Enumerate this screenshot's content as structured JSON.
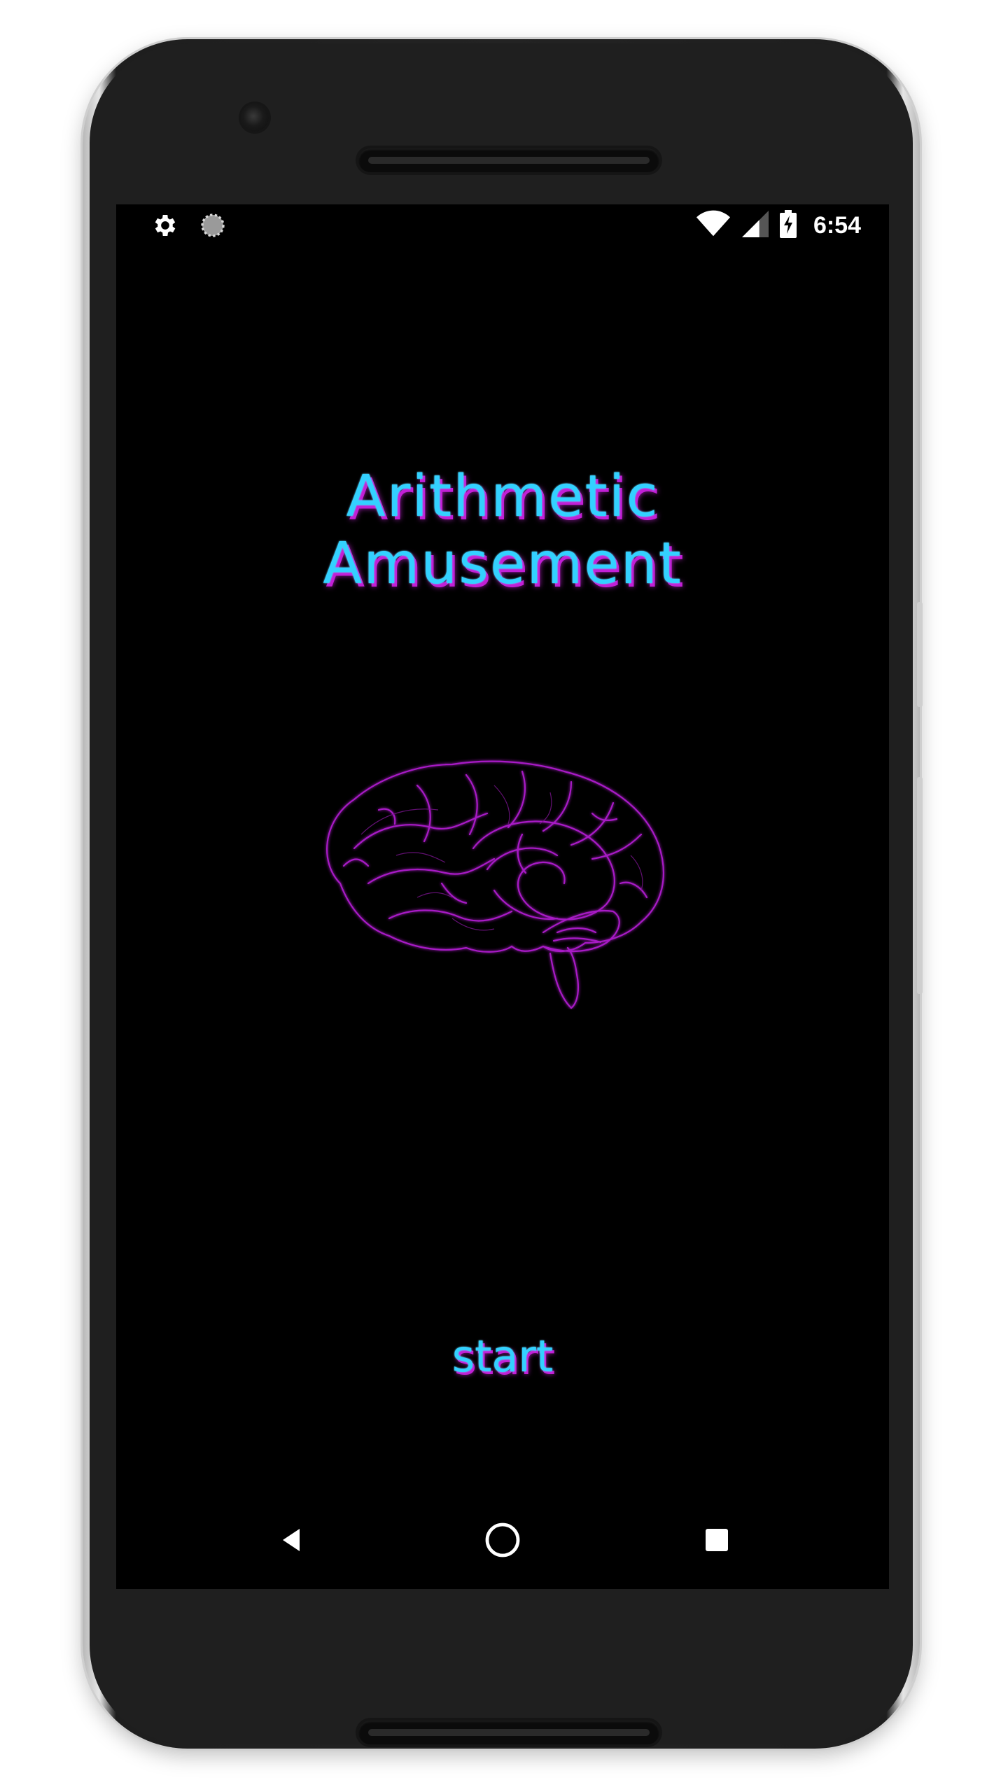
{
  "status_bar": {
    "left_icons": [
      "gear-icon",
      "sync-icon"
    ],
    "right_icons": [
      "wifi-icon",
      "signal-icon",
      "battery-charging-icon"
    ],
    "time": "6:54"
  },
  "app": {
    "title_line1": "Arithmetic",
    "title_line2": "Amusement",
    "start_label": "start",
    "illustration": "brain-icon"
  },
  "nav_bar": {
    "buttons": [
      "back-icon",
      "home-icon",
      "recents-icon"
    ]
  },
  "colors": {
    "title": "#33d1ff",
    "title_shadow": "#c21fd6",
    "brain": "#b21fd1",
    "background": "#000000"
  }
}
